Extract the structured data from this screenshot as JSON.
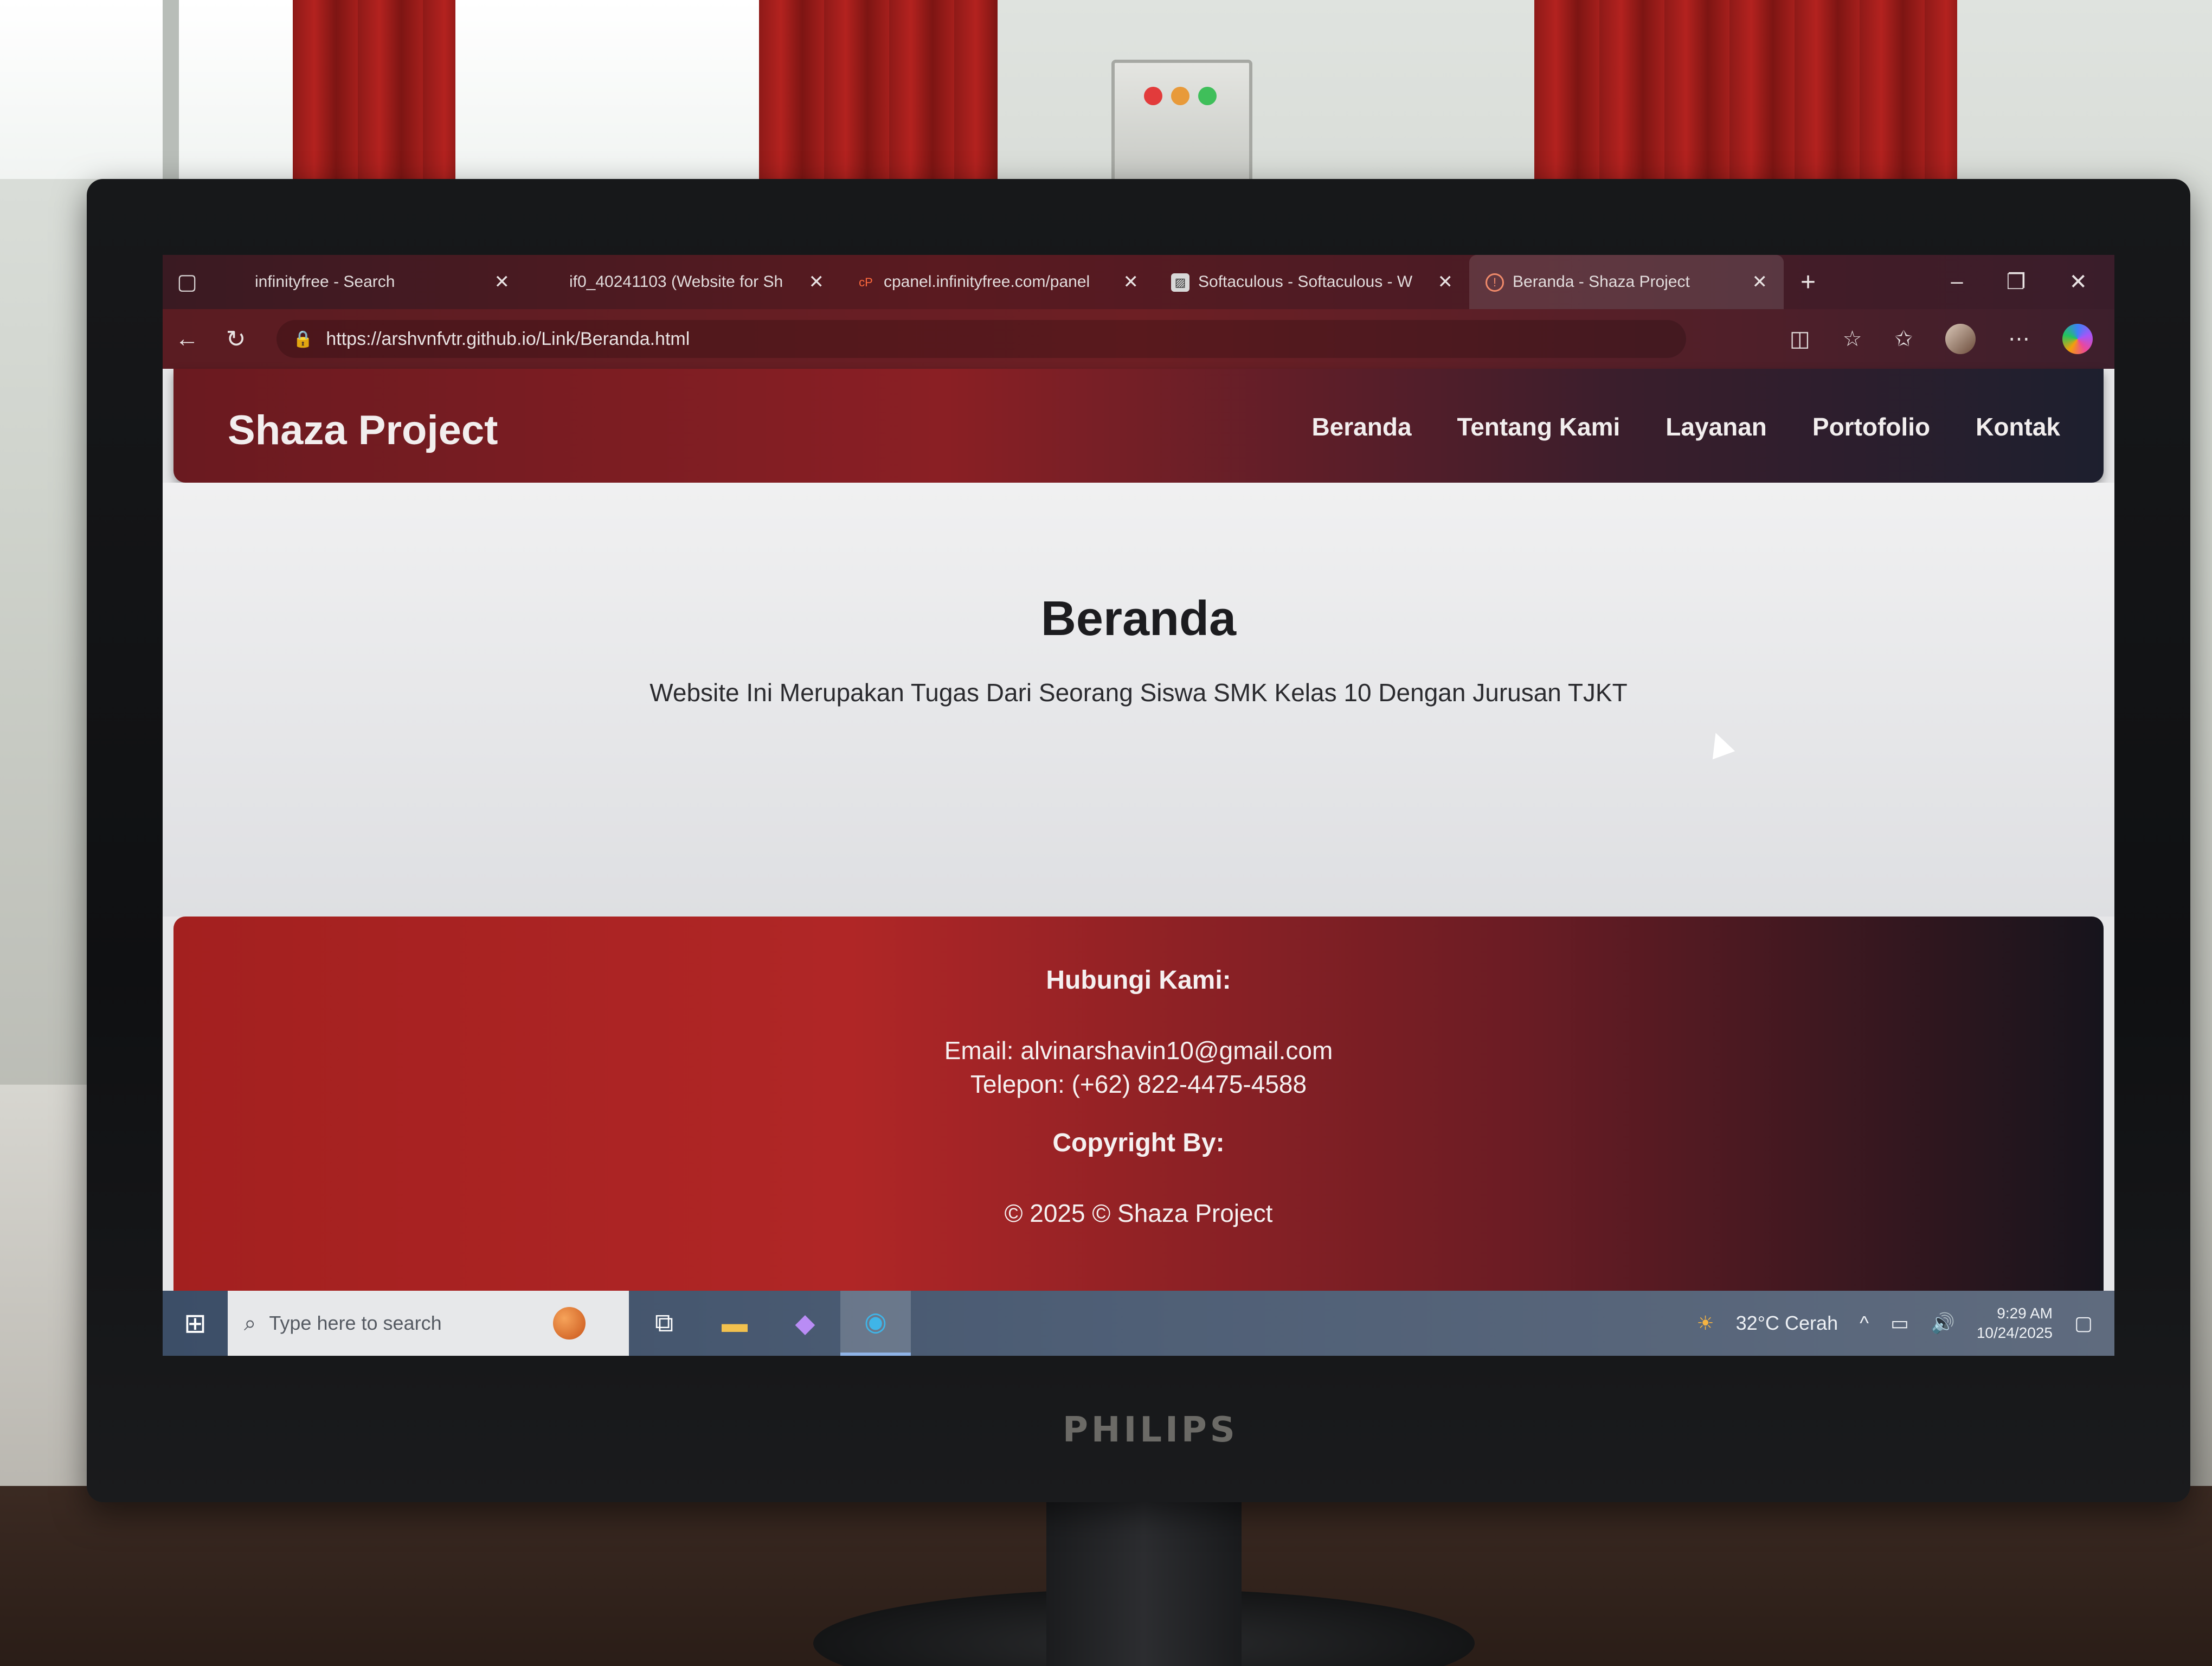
{
  "browser": {
    "tabs": [
      {
        "title": "infinityfree - Search",
        "active": false
      },
      {
        "title": "if0_40241103 (Website for Sh",
        "active": false
      },
      {
        "title": "cpanel.infinityfree.com/panel",
        "active": false
      },
      {
        "title": "Softaculous - Softaculous - W",
        "active": false
      },
      {
        "title": "Beranda - Shaza Project",
        "active": true
      }
    ],
    "url": "https://arshvnfvtr.github.io/Link/Beranda.html"
  },
  "site": {
    "logo": "Shaza Project",
    "nav": [
      "Beranda",
      "Tentang Kami",
      "Layanan",
      "Portofolio",
      "Kontak"
    ],
    "hero": {
      "title": "Beranda",
      "subtitle": "Website Ini Merupakan Tugas Dari Seorang Siswa SMK Kelas 10 Dengan Jurusan TJKT"
    },
    "footer": {
      "contact_heading": "Hubungi Kami:",
      "email": "Email: alvinarshavin10@gmail.com",
      "phone": "Telepon: (+62) 822-4475-4588",
      "copyright_heading": "Copyright By:",
      "copyright": "© 2025 © Shaza Project"
    }
  },
  "taskbar": {
    "search_placeholder": "Type here to search",
    "weather": "32°C  Cerah",
    "time": "9:29 AM",
    "date": "10/24/2025"
  },
  "monitor": {
    "brand": "PHILIPS"
  },
  "colors": {
    "accent_red": "#b02626",
    "header_dark": "#1d1f2e",
    "page_bg": "#e6e6e8"
  }
}
